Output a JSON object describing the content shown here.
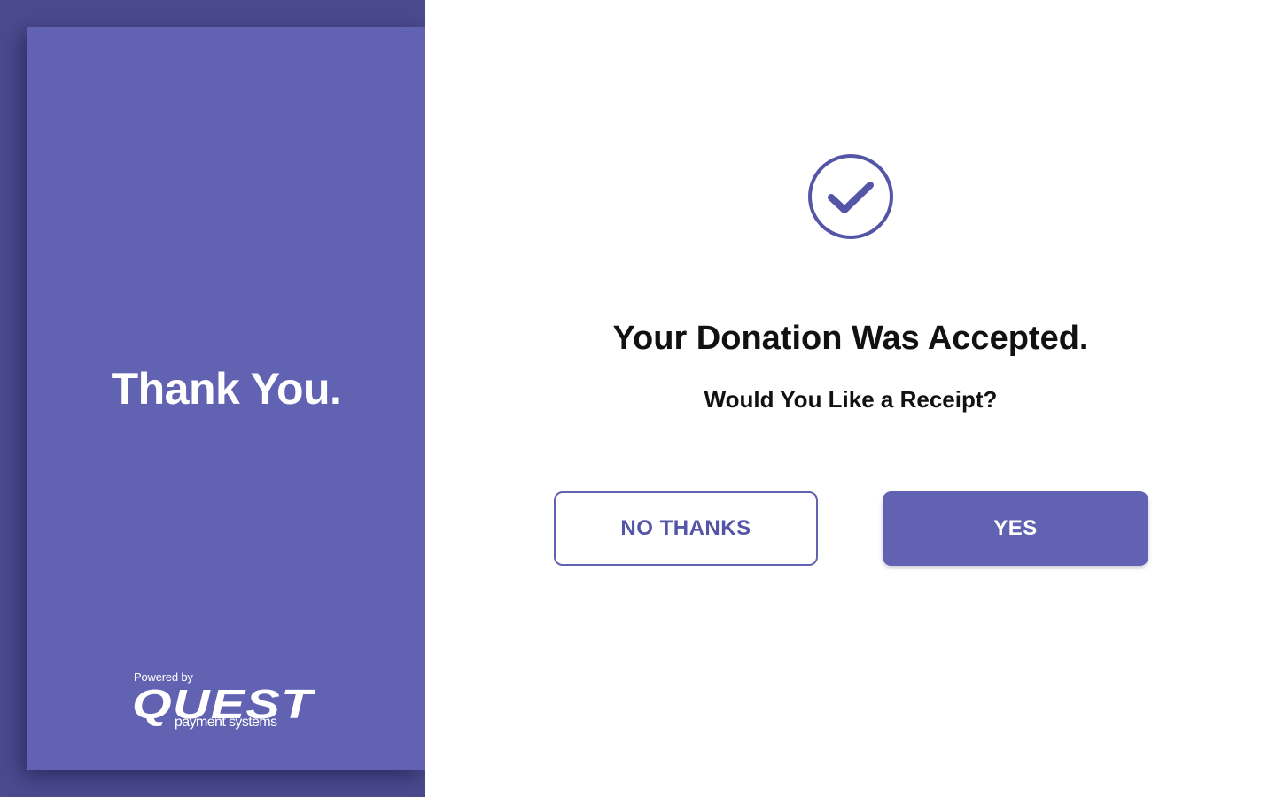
{
  "left_panel": {
    "heading": "Thank You.",
    "logo": {
      "powered_by": "Powered by",
      "brand": "QUEST",
      "tagline": "payment systems"
    }
  },
  "main": {
    "status_icon": "check-circle-icon",
    "title": "Your Donation Was Accepted.",
    "subtitle": "Would You Like a Receipt?",
    "buttons": {
      "no_label": "NO THANKS",
      "yes_label": "YES"
    }
  },
  "colors": {
    "accent": "#6262b2",
    "left_background": "#4b4a8f",
    "text": "#111111",
    "surface": "#ffffff"
  }
}
